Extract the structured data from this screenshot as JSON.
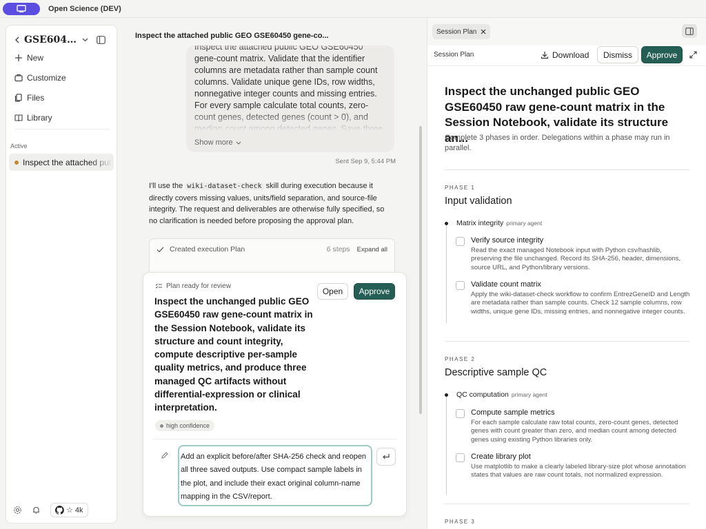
{
  "app": {
    "title": "Open Science (DEV)"
  },
  "sidebar": {
    "workspace_name": "GSE60450...",
    "items": [
      {
        "label": "New",
        "icon": "plus-icon"
      },
      {
        "label": "Customize",
        "icon": "briefcase-icon"
      },
      {
        "label": "Files",
        "icon": "files-icon"
      },
      {
        "label": "Library",
        "icon": "book-icon"
      }
    ],
    "active_section_label": "Active",
    "active_item": "Inspect the attached public",
    "github_stars": "4k"
  },
  "chat": {
    "title": "Inspect the attached public GEO GSE60450 gene-co...",
    "user_message": "Inspect the attached public GEO GSE60450 gene-count matrix. Validate that the identifier columns are metadata rather than sample count columns. Validate unique gene IDs, row widths, nonnegative integer counts and missing entries. For every sample calculate total counts, zero-count genes, detected genes (count > 0), and median count among detected genes. Save three managed artifacts: rnaseq-sample-qc.csv, rnaseq_library_sizes.png, and rnaseq_qc_report.md.",
    "show_more_label": "Show more",
    "sent_time": "Sent Sep 9, 5:44 PM",
    "assistant_pre": "I'll use the ",
    "assistant_code": "wiki-dataset-check",
    "assistant_post": " skill during execution because it directly covers missing values, units/field separation, and source-file integrity. The request and deliverables are otherwise fully specified, so no clarification is needed before proposing the approval plan.",
    "exec_card": {
      "label": "Created execution Plan",
      "steps": "6 steps",
      "expand": "Expand all"
    }
  },
  "review": {
    "label": "Plan ready for review",
    "open_label": "Open",
    "approve_label": "Approve",
    "title": "Inspect the unchanged public GEO GSE60450 raw gene-count matrix in the Session Notebook, validate its structure and count integrity, compute descriptive per-sample quality metrics, and produce three managed QC artifacts without differential-expression or clinical interpretation.",
    "confidence": "high confidence",
    "feedback": "Add an explicit before/after SHA-256 check and reopen all three saved outputs. Use compact sample labels in the plot, and include their exact original column-name mapping in the CSV/report."
  },
  "panel": {
    "tab_label": "Session Plan",
    "toolbar_title": "Session Plan",
    "download_label": "Download",
    "dismiss_label": "Dismiss",
    "approve_label": "Approve",
    "plan_title": "Inspect the unchanged public GEO GSE60450 raw gene-count matrix in the Session Notebook, validate its structure an...",
    "plan_subtitle": "Complete 3 phases in order. Delegations within a phase may run in parallel.",
    "phases": [
      {
        "label": "PHASE 1",
        "name": "Input validation",
        "agent": "Matrix integrity",
        "role": "primary agent",
        "tasks": [
          {
            "title": "Verify source integrity",
            "desc": "Read the exact managed Notebook input with Python csv/hashlib, preserving the file unchanged. Record its SHA-256, header, dimensions, source URL, and Python/library versions."
          },
          {
            "title": "Validate count matrix",
            "desc": "Apply the wiki-dataset-check workflow to confirm EntrezGeneID and Length are metadata rather than sample counts. Check 12 sample columns, row widths, unique gene IDs, missing entries, and nonnegative integer counts."
          }
        ]
      },
      {
        "label": "PHASE 2",
        "name": "Descriptive sample QC",
        "agent": "QC computation",
        "role": "primary agent",
        "tasks": [
          {
            "title": "Compute sample metrics",
            "desc": "For each sample calculate raw total counts, zero-count genes, detected genes with count greater than zero, and median count among detected genes using existing Python libraries only."
          },
          {
            "title": "Create library plot",
            "desc": "Use matplotlib to make a clearly labeled library-size plot whose annotation states that values are raw count totals, not normalized expression."
          }
        ]
      },
      {
        "label": "PHASE 3"
      }
    ]
  },
  "colors": {
    "accent_green": "#245e55",
    "brand_purple": "#5b4ee0",
    "active_dot": "#c48a2e",
    "focus_ring": "#9fc9c3"
  }
}
